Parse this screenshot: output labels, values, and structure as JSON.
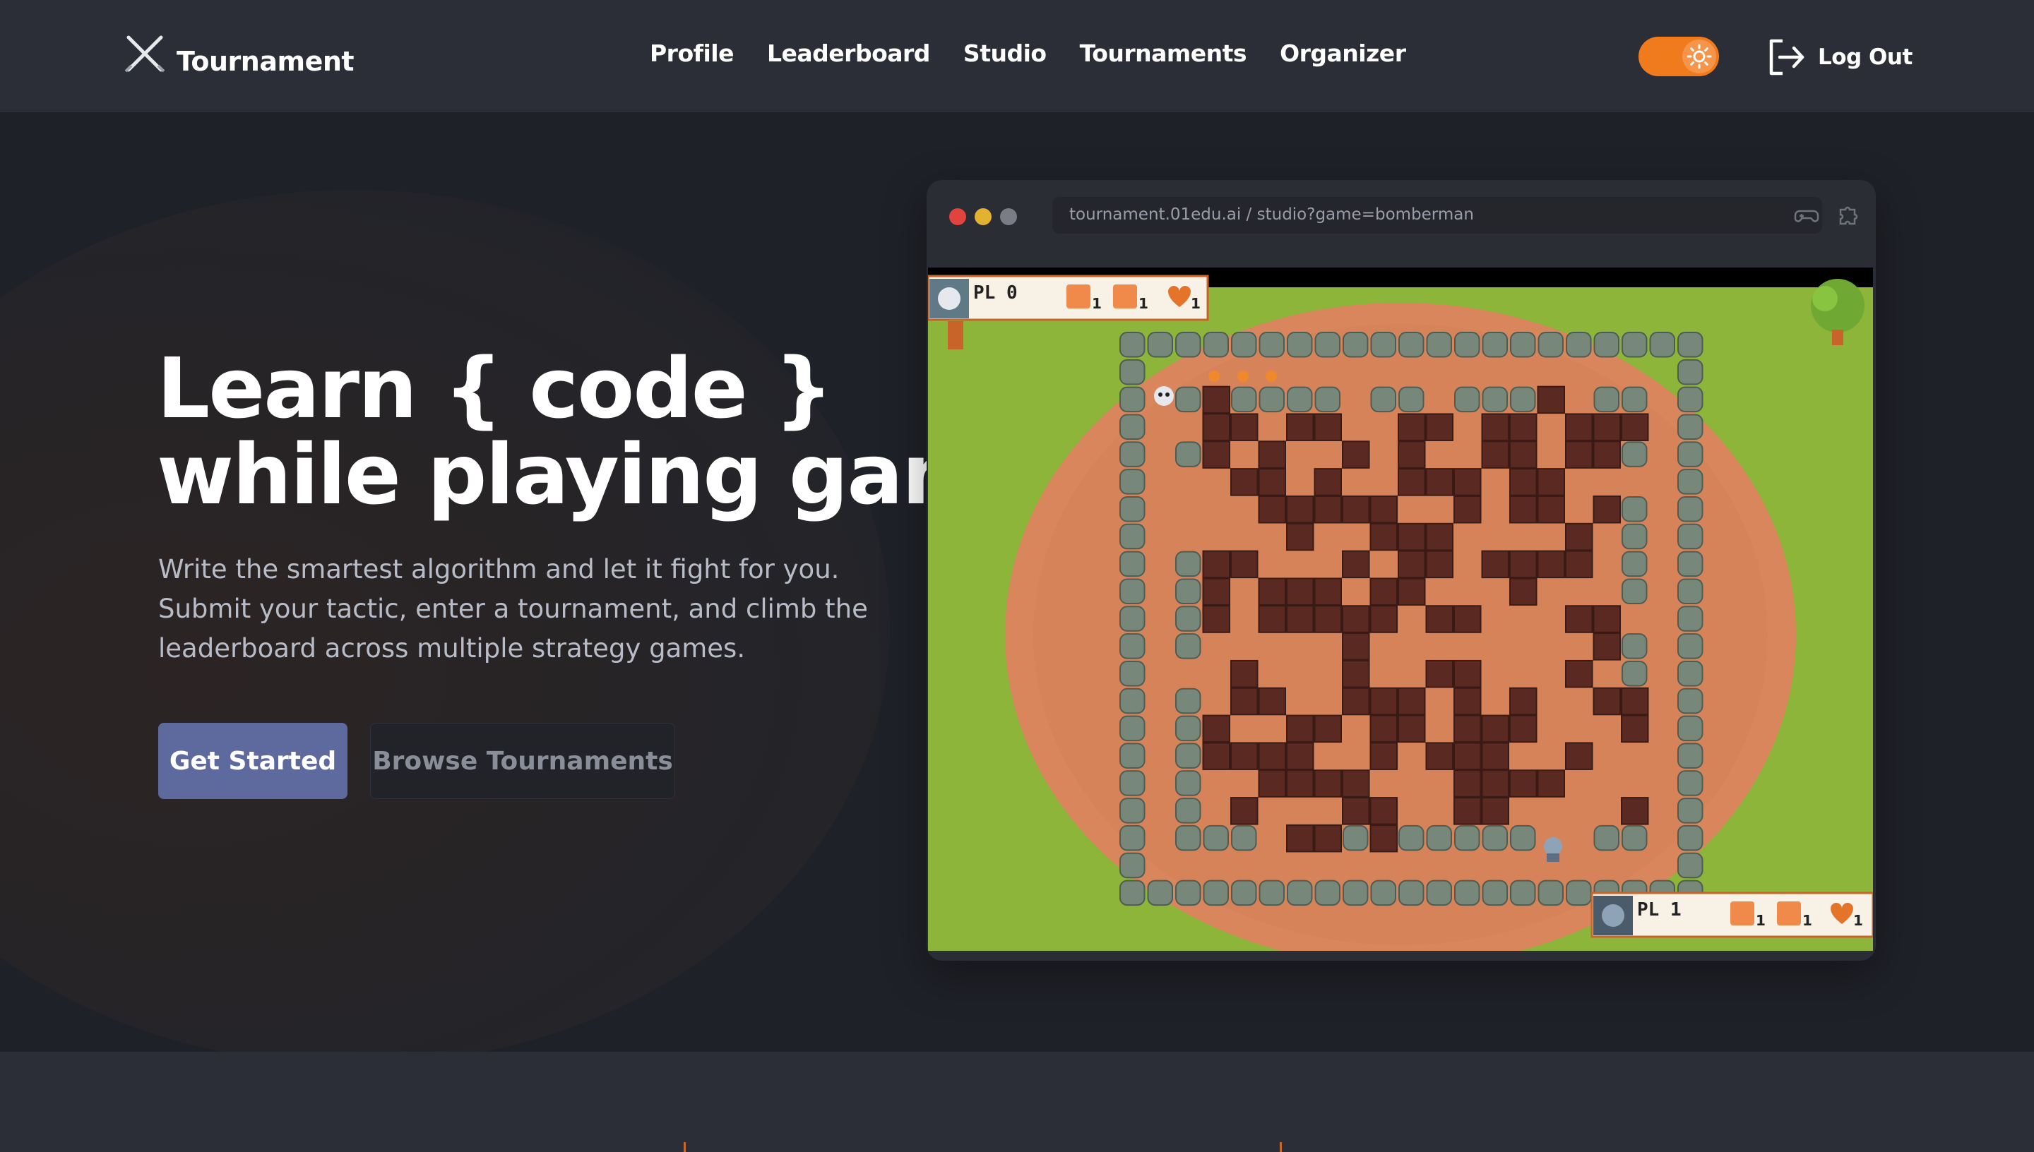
{
  "nav": {
    "brand": "Tournament",
    "menu": [
      {
        "label": "Profile"
      },
      {
        "label": "Leaderboard"
      },
      {
        "label": "Studio"
      },
      {
        "label": "Tournaments"
      },
      {
        "label": "Organizer"
      }
    ],
    "logout_label": "Log Out",
    "theme_toggle": "on"
  },
  "hero": {
    "title_part1": "Learn ",
    "title_code": "{ code }",
    "title_line2": "while playing game",
    "subtitle_lines": [
      "Write the smartest algorithm and let it fight for you.",
      "Submit your tactic, enter a tournament, and climb the",
      "leaderboard across multiple strategy games."
    ],
    "primary_button": "Get Started",
    "secondary_button": "Browse Tournaments"
  },
  "browser": {
    "url": "tournament.01edu.ai / studio?game=bomberman",
    "dots": [
      "#e0443c",
      "#e3b230",
      "#7a7d85"
    ]
  },
  "game": {
    "players": [
      {
        "label": "PL 0",
        "stats": [
          "1",
          "1",
          "1"
        ]
      },
      {
        "label": "PL 1",
        "stats": [
          "1",
          "1",
          "1"
        ]
      }
    ],
    "colors": {
      "grass": "#8cb53a",
      "dirt": "#d9865c",
      "stone": "#77877a",
      "brick": "#5a2a22"
    }
  }
}
